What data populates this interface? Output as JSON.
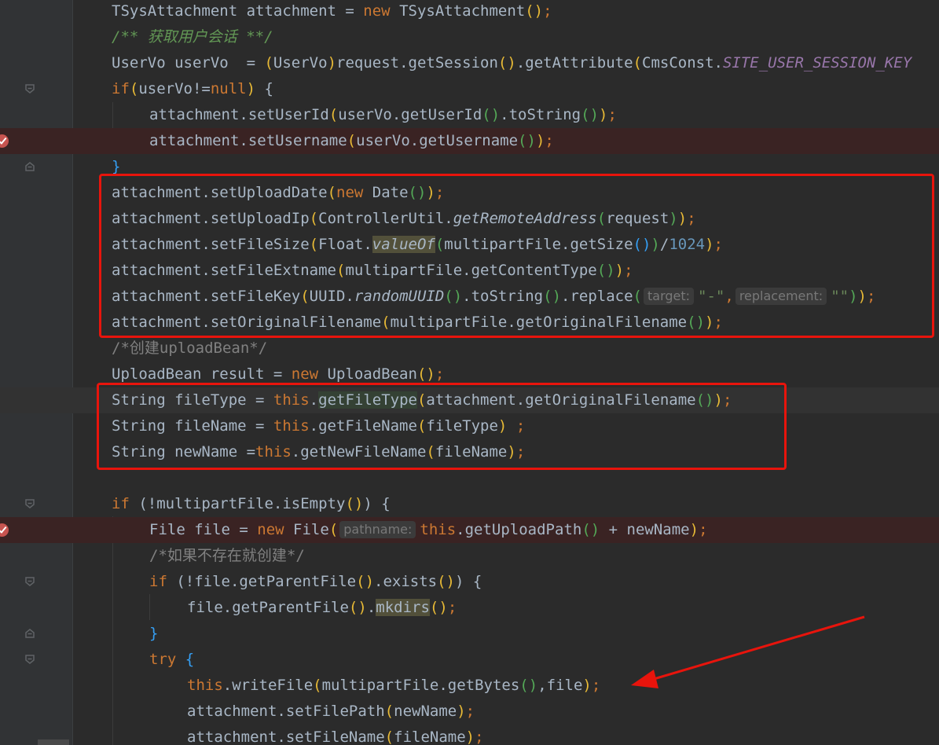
{
  "annotation_color": "#e8140c",
  "breakpoint_icon": "breakpoint-check-icon",
  "lines": {
    "l01": {
      "t1": "TSysAttachment attachment = ",
      "kw1": "new",
      "t2": " TSysAttachment",
      "p1": "(",
      "p2": ")",
      "semi": ";"
    },
    "l02": {
      "c1": "/**",
      "c2": " 获取用户会话 ",
      "c3": "**/"
    },
    "l03": {
      "t1": "UserVo userVo  = ",
      "p1": "(",
      "t2": "UserVo",
      "p2": ")",
      "t3": "request.getSession",
      "p3": "(",
      "p4": ")",
      "t4": ".getAttribute",
      "p5": "(",
      "t5": "CmsConst.",
      "st1": "SITE_USER_SESSION_KEY"
    },
    "l04": {
      "kw1": "if",
      "p1": "(",
      "t1": "userVo!=",
      "kw2": "null",
      "p2": ")",
      "t2": " {"
    },
    "l05": {
      "t1": "attachment.setUserId",
      "p1": "(",
      "t2": "userVo.getUserId",
      "p2": "(",
      "p3": ")",
      "t3": ".toString",
      "p4": "(",
      "p5": ")",
      "p6": ")",
      "semi": ";"
    },
    "l06": {
      "t1": "attachment.setUsername",
      "p1": "(",
      "t2": "userVo.getUsername",
      "p2": "(",
      "p3": ")",
      "p4": ")",
      "semi": ";"
    },
    "l07": {
      "t1": "}"
    },
    "l08": {
      "t1": "attachment.setUploadDate",
      "p1": "(",
      "kw1": "new",
      "t2": " Date",
      "p2": "(",
      "p3": ")",
      "p4": ")",
      "semi": ";"
    },
    "l09": {
      "t1": "attachment.setUploadIp",
      "p1": "(",
      "t2": "ControllerUtil.",
      "si1": "getRemoteAddress",
      "p2": "(",
      "t3": "request",
      "p3": ")",
      "p4": ")",
      "semi": ";"
    },
    "l10": {
      "t1": "attachment.setFileSize",
      "p1": "(",
      "t2": "Float.",
      "si1": "valueOf",
      "p2": "(",
      "t3": "multipartFile.getSize",
      "p3": "(",
      "p4": ")",
      "p5": ")",
      "t4": "/",
      "n1": "1024",
      "p6": ")",
      "semi": ";"
    },
    "l11": {
      "t1": "attachment.setFileExtname",
      "p1": "(",
      "t2": "multipartFile.getContentType",
      "p2": "(",
      "p3": ")",
      "p4": ")",
      "semi": ";"
    },
    "l12": {
      "t1": "attachment.setFileKey",
      "p1": "(",
      "t2": "UUID.",
      "si1": "randomUUID",
      "p2": "(",
      "p3": ")",
      "t3": ".toString",
      "p4": "(",
      "p5": ")",
      "t4": ".replace",
      "p6": "(",
      "h1": "target:",
      "s1": "\"-\"",
      "t5": ",",
      "h2": "replacement:",
      "s2": "\"\"",
      "p7": ")",
      "p8": ")",
      "semi": ";"
    },
    "l13": {
      "t1": "attachment.setOriginalFilename",
      "p1": "(",
      "t2": "multipartFile.getOriginalFilename",
      "p2": "(",
      "p3": ")",
      "p4": ")",
      "semi": ";"
    },
    "l14": {
      "c1": "/*创建uploadBean*/"
    },
    "l15": {
      "t1": "UploadBean result = ",
      "kw1": "new",
      "t2": " UploadBean",
      "p1": "(",
      "p2": ")",
      "semi": ";"
    },
    "l16": {
      "t1": "String fileType = ",
      "kw1": "this",
      "t2": ".",
      "hl1": "getFileType",
      "p1": "(",
      "t3": "attachment.getOriginalFilename",
      "p2": "(",
      "p3": ")",
      "p4": ")",
      "semi": ";"
    },
    "l17": {
      "t1": "String fileName = ",
      "kw1": "this",
      "t2": ".getFileName",
      "p1": "(",
      "t3": "fileType",
      "p2": ")",
      "semi": " ;"
    },
    "l18": {
      "t1": "String newName =",
      "kw1": "this",
      "t2": ".getNewFileName",
      "p1": "(",
      "t3": "fileName",
      "p2": ")",
      "semi": ";"
    },
    "l20": {
      "kw1": "if",
      "t1": " (!multipartFile.isEmpty",
      "p1": "(",
      "p2": ")",
      "t2": ") {"
    },
    "l21": {
      "t1": "File file = ",
      "kw1": "new",
      "t2": " File",
      "p1": "(",
      "h1": "pathname:",
      "kw2": "this",
      "t3": ".getUploadPath",
      "p2": "(",
      "p3": ")",
      "t4": " + newName",
      "p4": ")",
      "semi": ";"
    },
    "l22": {
      "c1": "/*如果不存在就创建*/"
    },
    "l23": {
      "kw1": "if",
      "t1": " (!file.getParentFile",
      "p1": "(",
      "p2": ")",
      "t2": ".exists",
      "p3": "(",
      "p4": ")",
      "t3": ") {"
    },
    "l24": {
      "t1": "file.getParentFile",
      "p1": "(",
      "p2": ")",
      "t2": ".",
      "hl1": "mkdirs",
      "p3": "(",
      "p4": ")",
      "semi": ";"
    },
    "l25": {
      "t1": "}"
    },
    "l26": {
      "kw1": "try",
      "t1": " {"
    },
    "l27": {
      "kw1": "this",
      "t1": ".writeFile",
      "p1": "(",
      "t2": "multipartFile.getBytes",
      "p2": "(",
      "p3": ")",
      "t3": ",file",
      "p4": ")",
      "semi": ";"
    },
    "l28": {
      "t1": "attachment.setFilePath",
      "p1": "(",
      "t2": "newName",
      "p2": ")",
      "semi": ";"
    },
    "l29": {
      "t1": "attachment.setFileName",
      "p1": "(",
      "t2": "fileName",
      "p2": ")",
      "semi": ";"
    }
  }
}
